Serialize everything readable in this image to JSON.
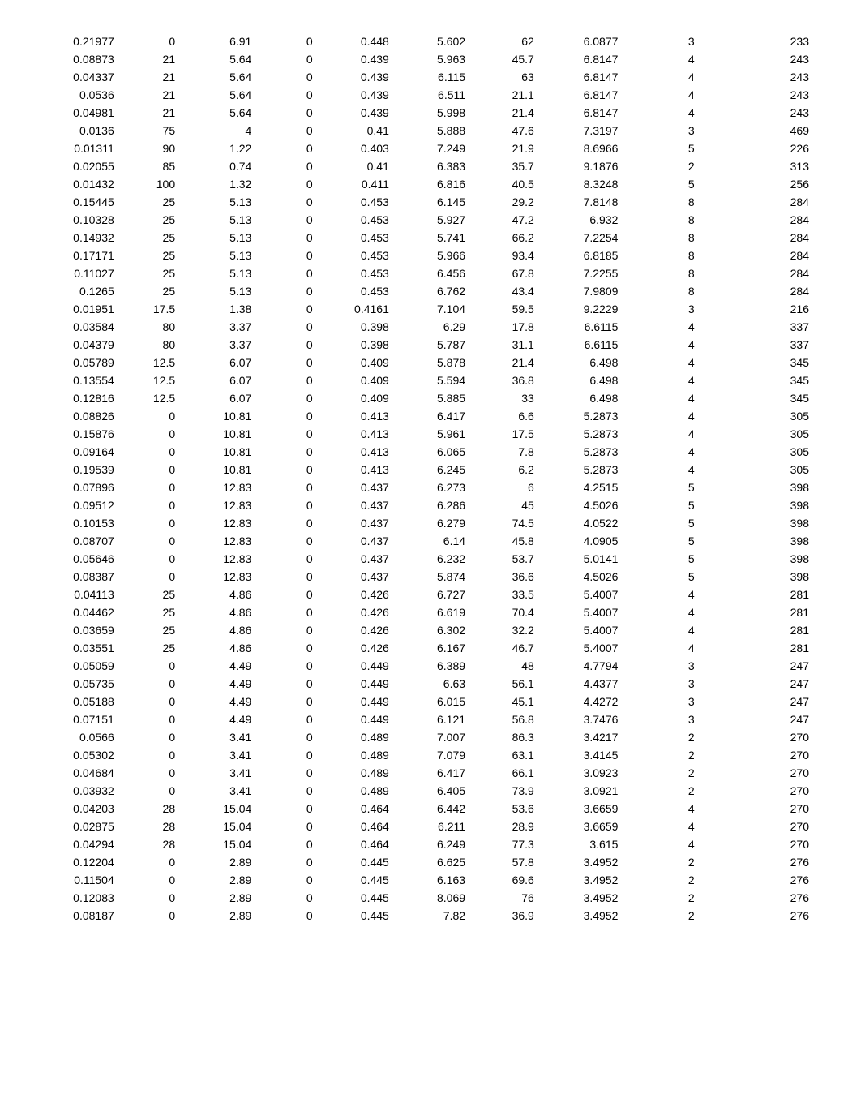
{
  "table": {
    "rows": [
      [
        "0.21977",
        "0",
        "6.91",
        "0",
        "0.448",
        "5.602",
        "62",
        "6.0877",
        "3",
        "233"
      ],
      [
        "0.08873",
        "21",
        "5.64",
        "0",
        "0.439",
        "5.963",
        "45.7",
        "6.8147",
        "4",
        "243"
      ],
      [
        "0.04337",
        "21",
        "5.64",
        "0",
        "0.439",
        "6.115",
        "63",
        "6.8147",
        "4",
        "243"
      ],
      [
        "0.0536",
        "21",
        "5.64",
        "0",
        "0.439",
        "6.511",
        "21.1",
        "6.8147",
        "4",
        "243"
      ],
      [
        "0.04981",
        "21",
        "5.64",
        "0",
        "0.439",
        "5.998",
        "21.4",
        "6.8147",
        "4",
        "243"
      ],
      [
        "0.0136",
        "75",
        "4",
        "0",
        "0.41",
        "5.888",
        "47.6",
        "7.3197",
        "3",
        "469"
      ],
      [
        "0.01311",
        "90",
        "1.22",
        "0",
        "0.403",
        "7.249",
        "21.9",
        "8.6966",
        "5",
        "226"
      ],
      [
        "0.02055",
        "85",
        "0.74",
        "0",
        "0.41",
        "6.383",
        "35.7",
        "9.1876",
        "2",
        "313"
      ],
      [
        "0.01432",
        "100",
        "1.32",
        "0",
        "0.411",
        "6.816",
        "40.5",
        "8.3248",
        "5",
        "256"
      ],
      [
        "0.15445",
        "25",
        "5.13",
        "0",
        "0.453",
        "6.145",
        "29.2",
        "7.8148",
        "8",
        "284"
      ],
      [
        "0.10328",
        "25",
        "5.13",
        "0",
        "0.453",
        "5.927",
        "47.2",
        "6.932",
        "8",
        "284"
      ],
      [
        "0.14932",
        "25",
        "5.13",
        "0",
        "0.453",
        "5.741",
        "66.2",
        "7.2254",
        "8",
        "284"
      ],
      [
        "0.17171",
        "25",
        "5.13",
        "0",
        "0.453",
        "5.966",
        "93.4",
        "6.8185",
        "8",
        "284"
      ],
      [
        "0.11027",
        "25",
        "5.13",
        "0",
        "0.453",
        "6.456",
        "67.8",
        "7.2255",
        "8",
        "284"
      ],
      [
        "0.1265",
        "25",
        "5.13",
        "0",
        "0.453",
        "6.762",
        "43.4",
        "7.9809",
        "8",
        "284"
      ],
      [
        "0.01951",
        "17.5",
        "1.38",
        "0",
        "0.4161",
        "7.104",
        "59.5",
        "9.2229",
        "3",
        "216"
      ],
      [
        "0.03584",
        "80",
        "3.37",
        "0",
        "0.398",
        "6.29",
        "17.8",
        "6.6115",
        "4",
        "337"
      ],
      [
        "0.04379",
        "80",
        "3.37",
        "0",
        "0.398",
        "5.787",
        "31.1",
        "6.6115",
        "4",
        "337"
      ],
      [
        "0.05789",
        "12.5",
        "6.07",
        "0",
        "0.409",
        "5.878",
        "21.4",
        "6.498",
        "4",
        "345"
      ],
      [
        "0.13554",
        "12.5",
        "6.07",
        "0",
        "0.409",
        "5.594",
        "36.8",
        "6.498",
        "4",
        "345"
      ],
      [
        "0.12816",
        "12.5",
        "6.07",
        "0",
        "0.409",
        "5.885",
        "33",
        "6.498",
        "4",
        "345"
      ],
      [
        "0.08826",
        "0",
        "10.81",
        "0",
        "0.413",
        "6.417",
        "6.6",
        "5.2873",
        "4",
        "305"
      ],
      [
        "0.15876",
        "0",
        "10.81",
        "0",
        "0.413",
        "5.961",
        "17.5",
        "5.2873",
        "4",
        "305"
      ],
      [
        "0.09164",
        "0",
        "10.81",
        "0",
        "0.413",
        "6.065",
        "7.8",
        "5.2873",
        "4",
        "305"
      ],
      [
        "0.19539",
        "0",
        "10.81",
        "0",
        "0.413",
        "6.245",
        "6.2",
        "5.2873",
        "4",
        "305"
      ],
      [
        "0.07896",
        "0",
        "12.83",
        "0",
        "0.437",
        "6.273",
        "6",
        "4.2515",
        "5",
        "398"
      ],
      [
        "0.09512",
        "0",
        "12.83",
        "0",
        "0.437",
        "6.286",
        "45",
        "4.5026",
        "5",
        "398"
      ],
      [
        "0.10153",
        "0",
        "12.83",
        "0",
        "0.437",
        "6.279",
        "74.5",
        "4.0522",
        "5",
        "398"
      ],
      [
        "0.08707",
        "0",
        "12.83",
        "0",
        "0.437",
        "6.14",
        "45.8",
        "4.0905",
        "5",
        "398"
      ],
      [
        "0.05646",
        "0",
        "12.83",
        "0",
        "0.437",
        "6.232",
        "53.7",
        "5.0141",
        "5",
        "398"
      ],
      [
        "0.08387",
        "0",
        "12.83",
        "0",
        "0.437",
        "5.874",
        "36.6",
        "4.5026",
        "5",
        "398"
      ],
      [
        "0.04113",
        "25",
        "4.86",
        "0",
        "0.426",
        "6.727",
        "33.5",
        "5.4007",
        "4",
        "281"
      ],
      [
        "0.04462",
        "25",
        "4.86",
        "0",
        "0.426",
        "6.619",
        "70.4",
        "5.4007",
        "4",
        "281"
      ],
      [
        "0.03659",
        "25",
        "4.86",
        "0",
        "0.426",
        "6.302",
        "32.2",
        "5.4007",
        "4",
        "281"
      ],
      [
        "0.03551",
        "25",
        "4.86",
        "0",
        "0.426",
        "6.167",
        "46.7",
        "5.4007",
        "4",
        "281"
      ],
      [
        "0.05059",
        "0",
        "4.49",
        "0",
        "0.449",
        "6.389",
        "48",
        "4.7794",
        "3",
        "247"
      ],
      [
        "0.05735",
        "0",
        "4.49",
        "0",
        "0.449",
        "6.63",
        "56.1",
        "4.4377",
        "3",
        "247"
      ],
      [
        "0.05188",
        "0",
        "4.49",
        "0",
        "0.449",
        "6.015",
        "45.1",
        "4.4272",
        "3",
        "247"
      ],
      [
        "0.07151",
        "0",
        "4.49",
        "0",
        "0.449",
        "6.121",
        "56.8",
        "3.7476",
        "3",
        "247"
      ],
      [
        "0.0566",
        "0",
        "3.41",
        "0",
        "0.489",
        "7.007",
        "86.3",
        "3.4217",
        "2",
        "270"
      ],
      [
        "0.05302",
        "0",
        "3.41",
        "0",
        "0.489",
        "7.079",
        "63.1",
        "3.4145",
        "2",
        "270"
      ],
      [
        "0.04684",
        "0",
        "3.41",
        "0",
        "0.489",
        "6.417",
        "66.1",
        "3.0923",
        "2",
        "270"
      ],
      [
        "0.03932",
        "0",
        "3.41",
        "0",
        "0.489",
        "6.405",
        "73.9",
        "3.0921",
        "2",
        "270"
      ],
      [
        "0.04203",
        "28",
        "15.04",
        "0",
        "0.464",
        "6.442",
        "53.6",
        "3.6659",
        "4",
        "270"
      ],
      [
        "0.02875",
        "28",
        "15.04",
        "0",
        "0.464",
        "6.211",
        "28.9",
        "3.6659",
        "4",
        "270"
      ],
      [
        "0.04294",
        "28",
        "15.04",
        "0",
        "0.464",
        "6.249",
        "77.3",
        "3.615",
        "4",
        "270"
      ],
      [
        "0.12204",
        "0",
        "2.89",
        "0",
        "0.445",
        "6.625",
        "57.8",
        "3.4952",
        "2",
        "276"
      ],
      [
        "0.11504",
        "0",
        "2.89",
        "0",
        "0.445",
        "6.163",
        "69.6",
        "3.4952",
        "2",
        "276"
      ],
      [
        "0.12083",
        "0",
        "2.89",
        "0",
        "0.445",
        "8.069",
        "76",
        "3.4952",
        "2",
        "276"
      ],
      [
        "0.08187",
        "0",
        "2.89",
        "0",
        "0.445",
        "7.82",
        "36.9",
        "3.4952",
        "2",
        "276"
      ]
    ]
  }
}
